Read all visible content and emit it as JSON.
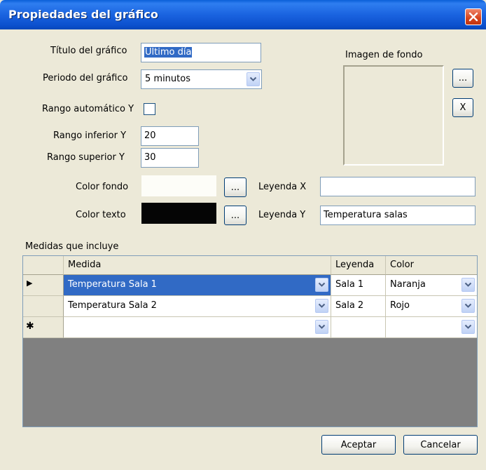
{
  "window": {
    "title": "Propiedades del gráfico"
  },
  "form": {
    "titulo_label": "Título del gráfico",
    "titulo_selected": "Último día",
    "periodo_label": "Periodo del gráfico",
    "periodo_value": "5 minutos",
    "rango_auto_label": "Rango automático Y",
    "rango_auto_checked": false,
    "rango_inf_label": "Rango inferior Y",
    "rango_inf_value": "20",
    "rango_sup_label": "Rango superior Y",
    "rango_sup_value": "30",
    "color_fondo_label": "Color fondo",
    "color_fondo_value": "#fdfdf8",
    "color_texto_label": "Color texto",
    "color_texto_value": "#050505",
    "leyenda_x_label": "Leyenda X",
    "leyenda_x_value": "",
    "leyenda_y_label": "Leyenda Y",
    "leyenda_y_value": "Temperatura salas",
    "browse_label": "...",
    "imagen_label": "Imagen de fondo",
    "clear_label": "X"
  },
  "medidas": {
    "label": "Medidas que incluye",
    "columns": [
      "Medida",
      "Leyenda",
      "Color"
    ],
    "rows": [
      {
        "marker": "▶",
        "medida": "Temperatura Sala 1",
        "leyenda": "Sala 1",
        "color": "Naranja",
        "selected": true
      },
      {
        "marker": "",
        "medida": "Temperatura Sala 2",
        "leyenda": "Sala 2",
        "color": "Rojo",
        "selected": false
      },
      {
        "marker": "✱",
        "medida": "",
        "leyenda": "",
        "color": "",
        "selected": false
      }
    ]
  },
  "buttons": {
    "accept": "Aceptar",
    "cancel": "Cancelar"
  },
  "colors": {
    "title_bar": "#0b5ed8",
    "selection": "#316ac5",
    "dialog_bg": "#ece9d8"
  }
}
